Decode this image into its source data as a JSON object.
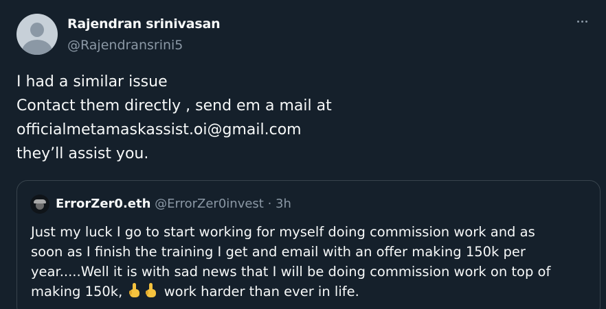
{
  "tweet": {
    "author_name": "Rajendran srinivasan",
    "author_handle": "@Rajendransrini5",
    "more_icon": "more-dots-icon",
    "text_lines": [
      "I had a similar issue",
      "Contact them directly , send em a mail at",
      "officialmetamaskassist.oi@gmail.com",
      "they’ll assist you."
    ]
  },
  "quote": {
    "author_name": "ErrorZer0.eth",
    "author_handle": "@ErrorZer0invest",
    "separator": " · ",
    "time": "3h",
    "text_lines": [
      "Just my luck I go to start working for myself doing commission work and as",
      "soon as I finish the training I get and email with an offer making 150k per",
      "year.....Well it is with sad news that I will be doing commission work on top of"
    ],
    "last_line_start": "making 150k, ",
    "last_line_end": " work harder than ever in life.",
    "emojis": [
      "pointing-up-hand-icon",
      "pointing-up-hand-icon"
    ]
  },
  "colors": {
    "background": "#15202b",
    "text": "#f7f9f9",
    "secondary": "#8b98a5",
    "border": "#38444d",
    "emoji": "#f5c23e"
  }
}
